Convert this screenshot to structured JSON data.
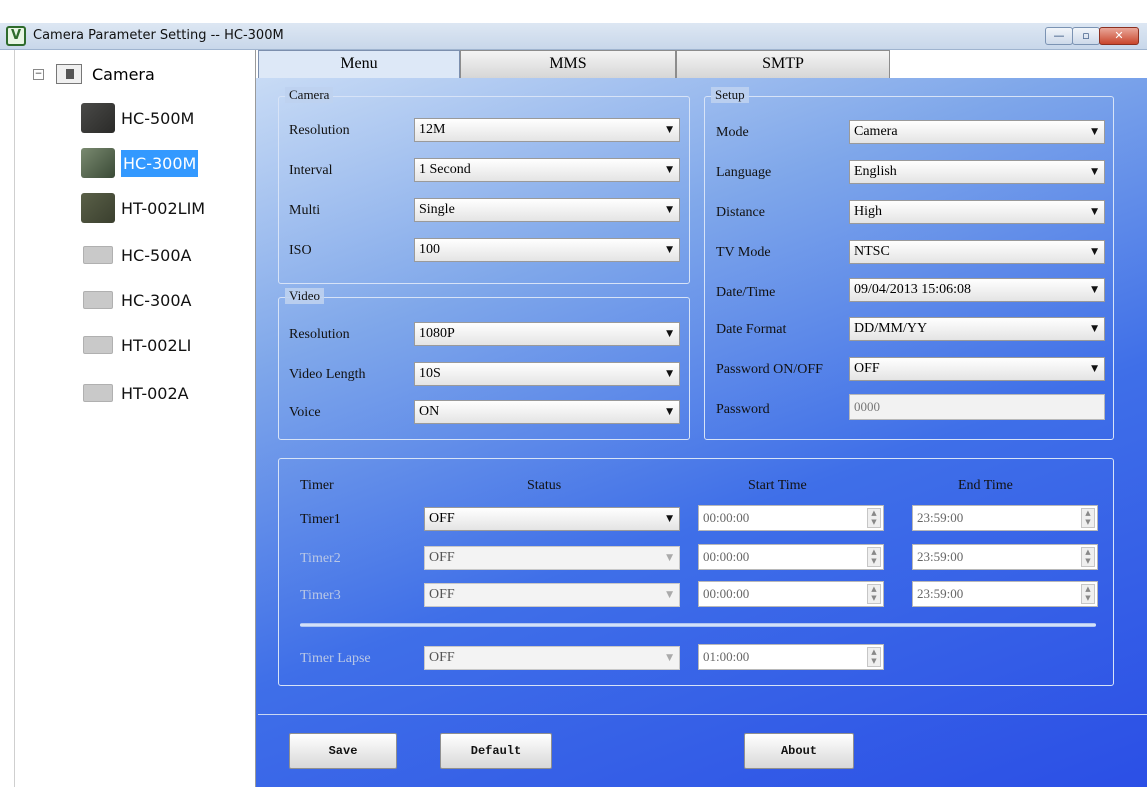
{
  "window": {
    "title": "Camera Parameter Setting -- HC-300M",
    "icon": "camera-app-icon",
    "controls": [
      "minimize-icon",
      "maximize-icon",
      "close-icon"
    ]
  },
  "tree": {
    "root_label": "Camera",
    "items": [
      {
        "label": "HC-500M",
        "thumb": "dark"
      },
      {
        "label": "HC-300M",
        "thumb": "mixed",
        "selected": true
      },
      {
        "label": "HT-002LIM",
        "thumb": "green"
      },
      {
        "label": "HC-500A",
        "thumb": "gray"
      },
      {
        "label": "HC-300A",
        "thumb": "gray"
      },
      {
        "label": "HT-002LI",
        "thumb": "gray"
      },
      {
        "label": "HT-002A",
        "thumb": "gray"
      }
    ]
  },
  "tabs": [
    {
      "label": "Menu",
      "active": true
    },
    {
      "label": "MMS"
    },
    {
      "label": "SMTP"
    }
  ],
  "camera": {
    "title": "Camera",
    "resolution_label": "Resolution",
    "resolution_value": "12M",
    "interval_label": "Interval",
    "interval_value": "1  Second",
    "multi_label": "Multi",
    "multi_value": "Single",
    "iso_label": "ISO",
    "iso_value": "100"
  },
  "video": {
    "title": "Video",
    "resolution_label": "Resolution",
    "resolution_value": "1080P",
    "length_label": "Video Length",
    "length_value": "10S",
    "voice_label": "Voice",
    "voice_value": "ON"
  },
  "setup": {
    "title": "Setup",
    "mode_label": "Mode",
    "mode_value": "Camera",
    "language_label": "Language",
    "language_value": "English",
    "distance_label": "Distance",
    "distance_value": "High",
    "tvmode_label": "TV Mode",
    "tvmode_value": "NTSC",
    "datetime_label": "Date/Time",
    "datetime_value": "09/04/2013 15:06:08",
    "dateformat_label": "Date Format",
    "dateformat_value": "DD/MM/YY",
    "password_onoff_label": "Password ON/OFF",
    "password_onoff_value": "OFF",
    "password_label": "Password",
    "password_value": "0000"
  },
  "timer": {
    "head_timer": "Timer",
    "head_status": "Status",
    "head_start": "Start Time",
    "head_end": "End Time",
    "rows": [
      {
        "label": "Timer1",
        "status": "OFF",
        "start": "00:00:00",
        "end": "23:59:00"
      },
      {
        "label": "Timer2",
        "status": "OFF",
        "start": "00:00:00",
        "end": "23:59:00"
      },
      {
        "label": "Timer3",
        "status": "OFF",
        "start": "00:00:00",
        "end": "23:59:00"
      }
    ],
    "lapse": {
      "label": "Timer Lapse",
      "status": "OFF",
      "interval": "01:00:00"
    }
  },
  "buttons": {
    "save": "Save",
    "default": "Default",
    "about": "About"
  }
}
